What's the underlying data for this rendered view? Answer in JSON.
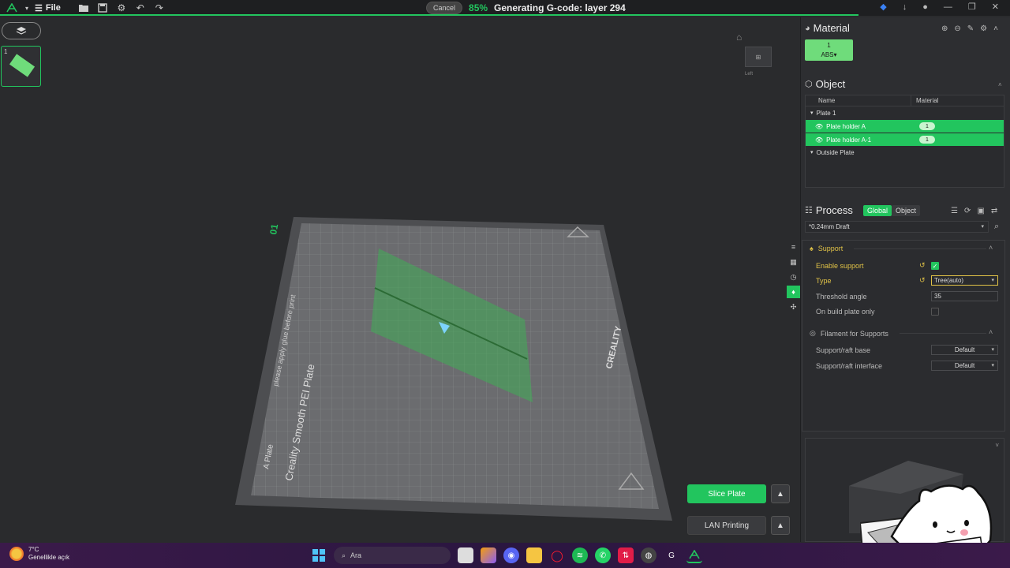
{
  "topbar": {
    "file_label": "File",
    "cancel_label": "Cancel",
    "progress_percent": "85%",
    "progress_fraction": 0.85,
    "status_text": "Generating G-code: layer 294"
  },
  "left": {
    "plate_thumb_number": "1"
  },
  "viewport": {
    "plate_number": "01",
    "plate_brand_text": "Creality Smooth PEI Plate",
    "plate_note": "please apply glue before print",
    "plate_label": "A Plate",
    "creality_text": "CREALITY",
    "viewcube_label": "Left"
  },
  "buttons": {
    "slice_plate": "Slice Plate",
    "lan_printing": "LAN Printing"
  },
  "material": {
    "title": "Material",
    "chip_number": "1",
    "chip_material": "ABS"
  },
  "object": {
    "title": "Object",
    "col_name": "Name",
    "col_material": "Material",
    "rows": [
      {
        "name": "Plate 1",
        "selected": false
      },
      {
        "name": "Plate holder A",
        "selected": true,
        "material": "1"
      },
      {
        "name": "Plate holder A-1",
        "selected": true,
        "material": "1"
      },
      {
        "name": "Outside Plate",
        "selected": false
      }
    ]
  },
  "process": {
    "title": "Process",
    "tab_global": "Global",
    "tab_object": "Object",
    "preset": "*0.24mm Draft",
    "support_group": "Support",
    "enable_support_label": "Enable support",
    "enable_support_checked": true,
    "type_label": "Type",
    "type_value": "Tree(auto)",
    "threshold_label": "Threshold angle",
    "threshold_value": "35",
    "build_plate_only_label": "On build plate only",
    "build_plate_only_checked": false,
    "filament_group": "Filament for Supports",
    "raft_base_label": "Support/raft base",
    "raft_base_value": "Default",
    "raft_interface_label": "Support/raft interface",
    "raft_interface_value": "Default"
  },
  "taskbar": {
    "temperature": "7°C",
    "weather_desc": "Genellikle açık",
    "search_placeholder": "Ara"
  },
  "colors": {
    "accent": "#22c55e",
    "modified": "#e0c247",
    "panel": "#2d2e31",
    "bg": "#2a2b2d"
  }
}
